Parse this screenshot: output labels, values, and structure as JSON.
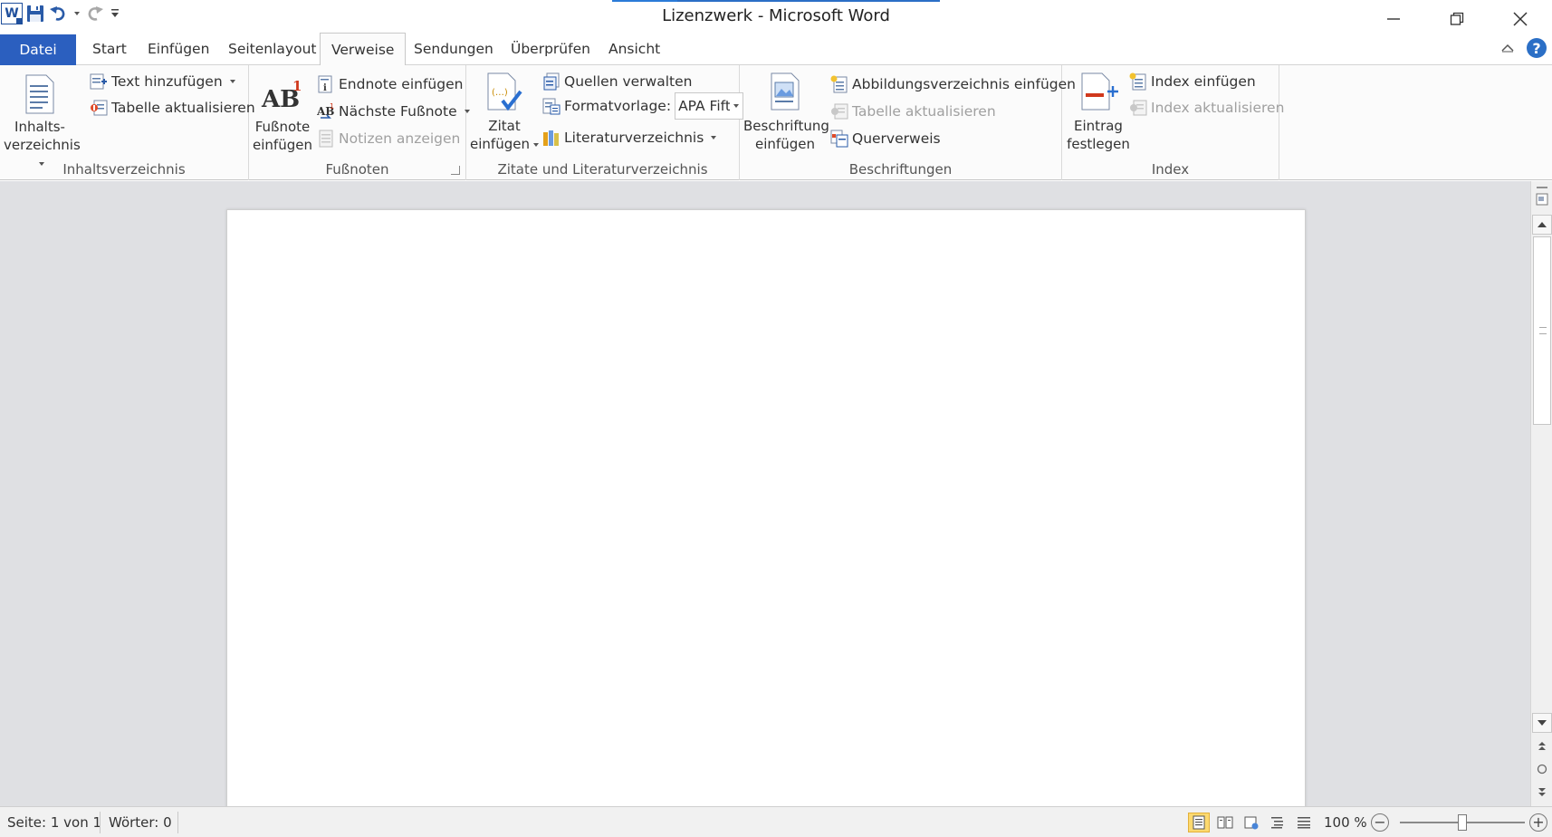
{
  "window": {
    "title": "Lizenzwerk - Microsoft Word",
    "load_progress": 0.2
  },
  "qat": {
    "items": [
      "word-app-icon",
      "save-icon",
      "undo-icon",
      "redo-icon",
      "customize-qat-icon"
    ]
  },
  "tabs": [
    {
      "label": "Datei"
    },
    {
      "label": "Start"
    },
    {
      "label": "Einfügen"
    },
    {
      "label": "Seitenlayout"
    },
    {
      "label": "Verweise"
    },
    {
      "label": "Sendungen"
    },
    {
      "label": "Überprüfen"
    },
    {
      "label": "Ansicht"
    }
  ],
  "active_tab": "Verweise",
  "ribbon": {
    "toc": {
      "group_label": "Inhaltsverzeichnis",
      "toc_button_line1": "Inhalts-",
      "toc_button_line2": "verzeichnis",
      "add_text": "Text hinzufügen",
      "update_table": "Tabelle aktualisieren"
    },
    "footnotes": {
      "group_label": "Fußnoten",
      "insert_footnote_line1": "Fußnote",
      "insert_footnote_line2": "einfügen",
      "insert_endnote": "Endnote einfügen",
      "next_footnote": "Nächste Fußnote",
      "show_notes": "Notizen anzeigen"
    },
    "citations": {
      "group_label": "Zitate und Literaturverzeichnis",
      "insert_citation_line1": "Zitat",
      "insert_citation_line2": "einfügen",
      "manage_sources": "Quellen verwalten",
      "style_label": "Formatvorlage:",
      "style_value": "APA Fifth",
      "bibliography": "Literaturverzeichnis"
    },
    "captions": {
      "group_label": "Beschriftungen",
      "insert_caption_line1": "Beschriftung",
      "insert_caption_line2": "einfügen",
      "insert_table_of_figures": "Abbildungsverzeichnis einfügen",
      "update_table": "Tabelle aktualisieren",
      "cross_reference": "Querverweis"
    },
    "index": {
      "group_label": "Index",
      "mark_entry_line1": "Eintrag",
      "mark_entry_line2": "festlegen",
      "insert_index": "Index einfügen",
      "update_index": "Index aktualisieren"
    }
  },
  "status": {
    "page": "Seite: 1 von 1",
    "words": "Wörter: 0",
    "zoom": "100 %",
    "zoom_fraction": 0.5
  },
  "colors": {
    "file_tab": "#2b5fbf",
    "accent": "#2b6fc6",
    "active_view": "#fcd96f"
  }
}
